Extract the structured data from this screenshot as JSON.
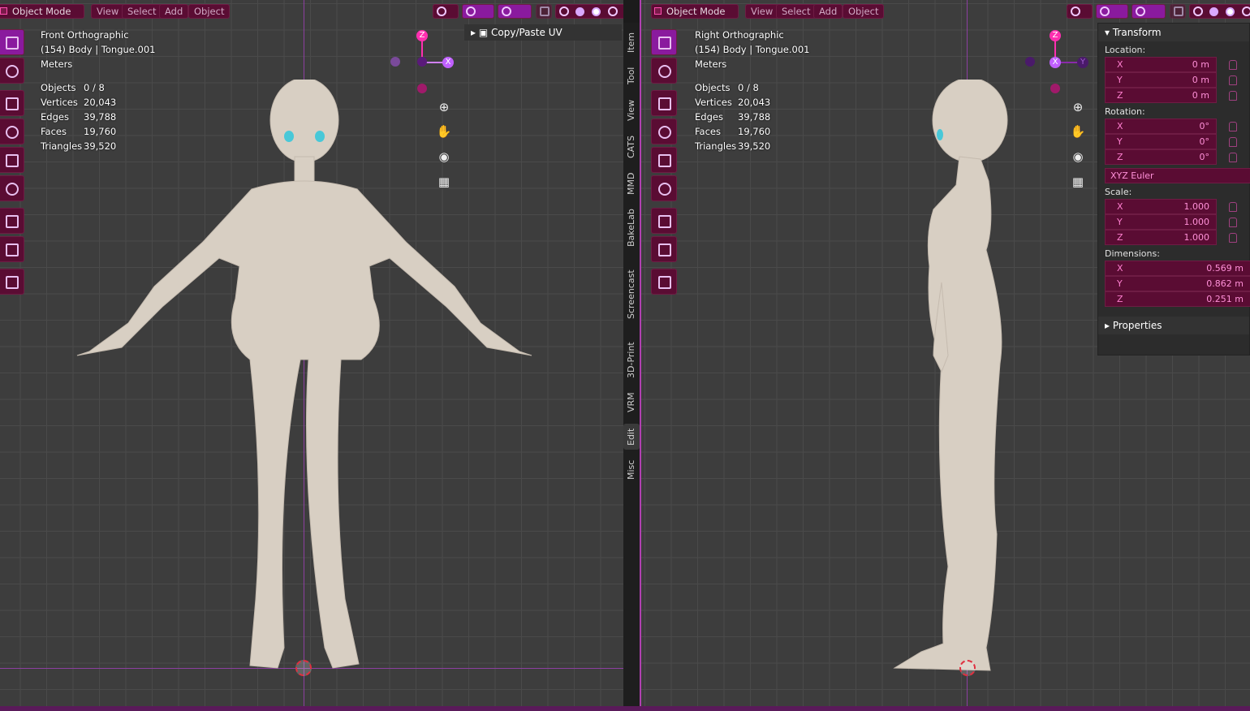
{
  "left_viewport": {
    "header": {
      "mode": "Object Mode",
      "menus": [
        "View",
        "Select",
        "Add",
        "Object"
      ]
    },
    "overlay": {
      "view_name": "Front Orthographic",
      "collection": "(154) Body | Tongue.001",
      "units": "Meters"
    },
    "stats": [
      {
        "label": "Objects",
        "value": "0 / 8"
      },
      {
        "label": "Vertices",
        "value": "20,043"
      },
      {
        "label": "Edges",
        "value": "39,788"
      },
      {
        "label": "Faces",
        "value": "19,760"
      },
      {
        "label": "Triangles",
        "value": "39,520"
      }
    ],
    "gizmo": {
      "up": "Z",
      "right": "X"
    },
    "sidebar_panel": "Copy/Paste UV"
  },
  "right_viewport": {
    "header": {
      "mode": "Object Mode",
      "menus": [
        "View",
        "Select",
        "Add",
        "Object"
      ]
    },
    "overlay": {
      "view_name": "Right Orthographic",
      "collection": "(154) Body | Tongue.001",
      "units": "Meters"
    },
    "stats": [
      {
        "label": "Objects",
        "value": "0 / 8"
      },
      {
        "label": "Vertices",
        "value": "20,043"
      },
      {
        "label": "Edges",
        "value": "39,788"
      },
      {
        "label": "Faces",
        "value": "19,760"
      },
      {
        "label": "Triangles",
        "value": "39,520"
      }
    ],
    "gizmo": {
      "up": "Z",
      "right": "Y",
      "left": "X"
    }
  },
  "n_tabs": [
    "Item",
    "Tool",
    "View",
    "CATS",
    "MMD",
    "BakeLab",
    "Screencast Keys",
    "3D-Print",
    "VRM",
    "Edit",
    "Misc"
  ],
  "active_n_tab": "Edit",
  "transform": {
    "title": "Transform",
    "location_label": "Location:",
    "location": [
      {
        "axis": "X",
        "value": "0 m"
      },
      {
        "axis": "Y",
        "value": "0 m"
      },
      {
        "axis": "Z",
        "value": "0 m"
      }
    ],
    "rotation_label": "Rotation:",
    "rotation": [
      {
        "axis": "X",
        "value": "0°"
      },
      {
        "axis": "Y",
        "value": "0°"
      },
      {
        "axis": "Z",
        "value": "0°"
      }
    ],
    "rotation_mode": "XYZ Euler",
    "scale_label": "Scale:",
    "scale": [
      {
        "axis": "X",
        "value": "1.000"
      },
      {
        "axis": "Y",
        "value": "1.000"
      },
      {
        "axis": "Z",
        "value": "1.000"
      }
    ],
    "dimensions_label": "Dimensions:",
    "dimensions": [
      {
        "axis": "X",
        "value": "0.569 m"
      },
      {
        "axis": "Y",
        "value": "0.862 m"
      },
      {
        "axis": "Z",
        "value": "0.251 m"
      }
    ],
    "properties_label": "Properties"
  },
  "colors": {
    "accent": "#8a1a9e",
    "button_bg": "#5a0c33",
    "viewport_bg": "#3d3d3d",
    "skin": "#d8cfc3"
  }
}
